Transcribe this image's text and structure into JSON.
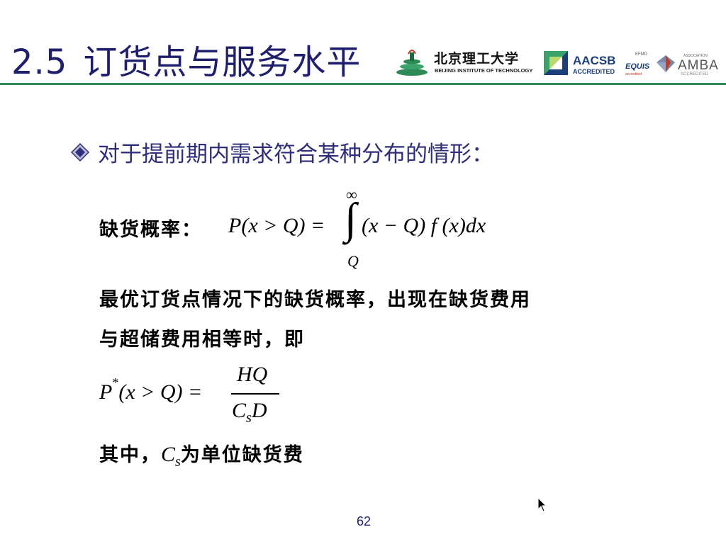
{
  "slide": {
    "title_number": "2.5",
    "title_text": "订货点与服务水平",
    "page_number": "62"
  },
  "logos": {
    "bit_name_cn": "北京理工大学",
    "bit_name_en": "BEIJING INSTITUTE OF TECHNOLOGY",
    "aacsb": "AACSB",
    "aacsb_sub": "ACCREDITED",
    "efmd": "EFMD",
    "equis": "EQUIS",
    "equis_sub": "accredited",
    "amba_assoc": "ASSOCIATION",
    "amba": "AMBA",
    "amba_sub": "ACCREDITED"
  },
  "content": {
    "bullet": "对于提前期内需求符合某种分布的情形：",
    "stockout_label": "缺货概率：",
    "formula1": {
      "lhs": "P(x > Q) =",
      "upper_limit": "∞",
      "lower_limit": "Q",
      "integral": "∫",
      "integrand": "(x − Q) f (x)dx"
    },
    "line1": "最优订货点情况下的缺货概率，出现在缺货费用",
    "line2": "与超储费用相等时，即",
    "formula2": {
      "lhs_p": "P",
      "lhs_star": "*",
      "lhs_rest": "(x > Q) =",
      "numerator": "HQ",
      "denom_c": "C",
      "denom_s": "s",
      "denom_d": "D"
    },
    "last_line_prefix": "其中，",
    "last_c": "C",
    "last_s": "s",
    "last_line_suffix": "为单位缺货费"
  },
  "colors": {
    "title": "#1f1f6e",
    "rule": "#2e8b57",
    "bullet_text": "#2e2e7a"
  }
}
